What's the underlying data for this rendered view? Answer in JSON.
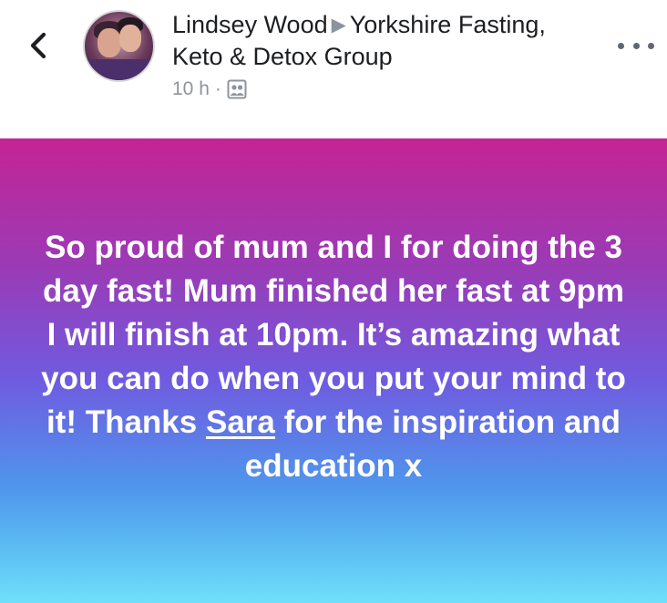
{
  "header": {
    "back_icon": "chevron-left-icon",
    "author": "Lindsey Wood",
    "separator_icon": "right-triangle-icon",
    "group": "Yorkshire Fasting, Keto & Detox Group",
    "time": "10 h",
    "dot": "·",
    "audience_icon": "group-audience-icon",
    "more_icon": "more-dots-icon"
  },
  "post": {
    "text_before": "So proud of mum and I for doing the 3 day fast! Mum finished her fast at 9pm I will finish at 10pm. It’s amazing what you can do when you put your mind to it! Thanks ",
    "mention": "Sara",
    "text_after": " for the inspiration and education x",
    "gradient_colors": [
      "#c42494",
      "#9a3bb6",
      "#6f5be0",
      "#4f96ec",
      "#70e0fb"
    ]
  }
}
